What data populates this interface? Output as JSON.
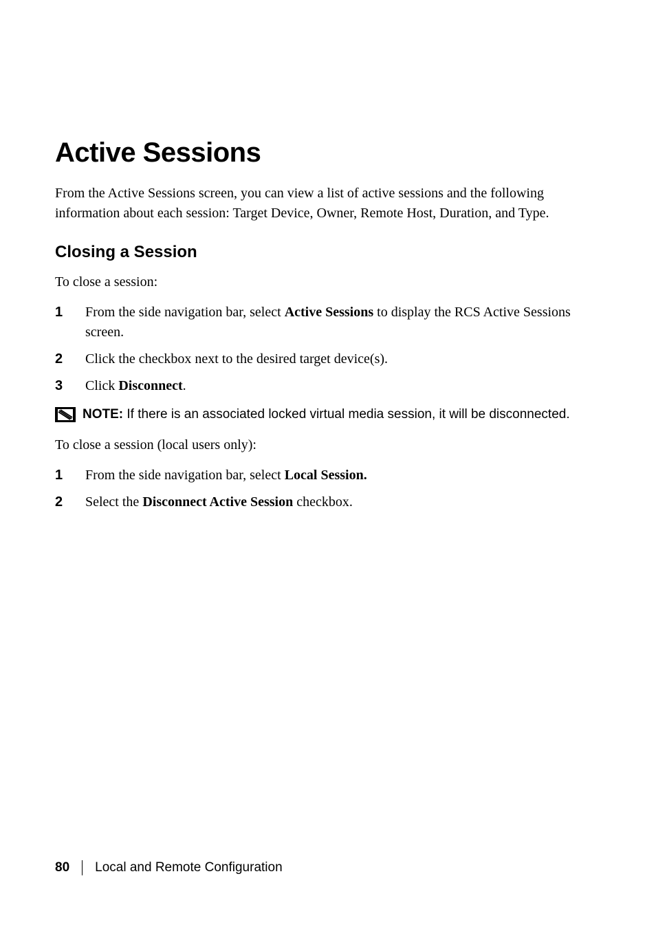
{
  "headings": {
    "main": "Active Sessions",
    "sub": "Closing a Session"
  },
  "intro": "From the Active Sessions screen, you can view a list of active sessions and the following information about each session: Target Device, Owner, Remote Host, Duration, and Type.",
  "lead1": "To close a session:",
  "steps1": [
    {
      "num": "1",
      "pre": "From the side navigation bar, select ",
      "bold": "Active Sessions",
      "post": " to display the RCS Active Sessions screen."
    },
    {
      "num": "2",
      "pre": "Click the checkbox next to the desired target device(s).",
      "bold": "",
      "post": ""
    },
    {
      "num": "3",
      "pre": "Click ",
      "bold": "Disconnect",
      "post": "."
    }
  ],
  "note": {
    "label": "NOTE:",
    "text": " If there is an associated locked virtual media session, it will be disconnected."
  },
  "lead2": "To close a session (local users only):",
  "steps2": [
    {
      "num": "1",
      "pre": "From the side navigation bar, select ",
      "bold": "Local Session.",
      "post": ""
    },
    {
      "num": "2",
      "pre": "Select the ",
      "bold": "Disconnect Active Session",
      "post": " checkbox."
    }
  ],
  "footer": {
    "page": "80",
    "section": "Local and Remote Configuration"
  }
}
